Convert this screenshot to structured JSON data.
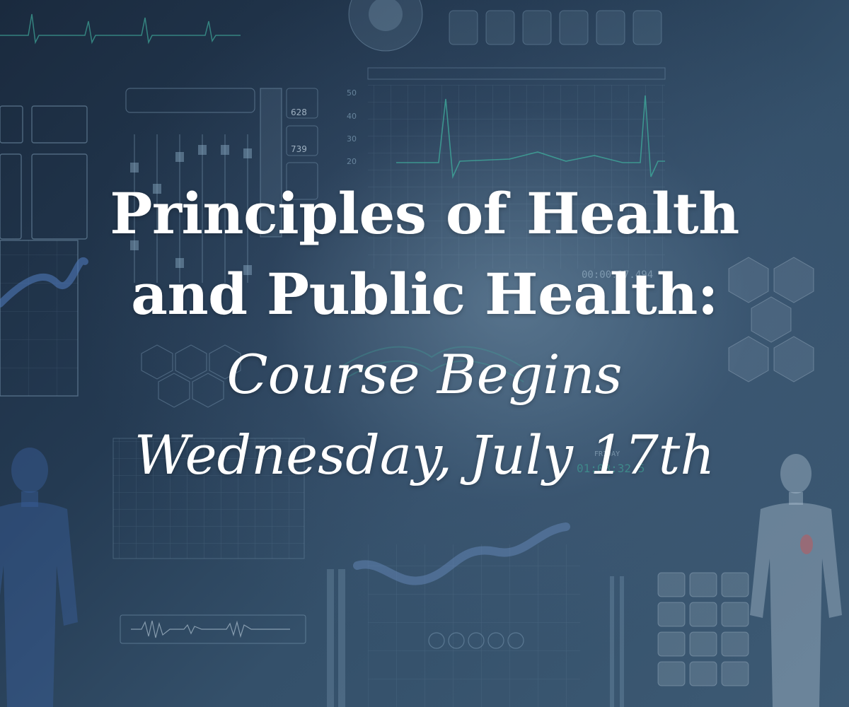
{
  "headline": {
    "line1": "Principles of Health",
    "line2": "and Public Health:",
    "line3": "Course Begins",
    "line4": "Wednesday, July 17th"
  },
  "background": {
    "readouts": {
      "value_a": "628",
      "value_b": "739",
      "timer_a": "00:00:17.494",
      "timer_b": "01:03:32.5",
      "label_friday": "FRIDAY",
      "axis_labels": [
        "50",
        "40",
        "30",
        "20"
      ]
    },
    "colors": {
      "base": "#1b2c40",
      "overlay_line": "#8fb0c8",
      "ecg_trace": "#3fa89a",
      "text": "#ffffff"
    }
  }
}
